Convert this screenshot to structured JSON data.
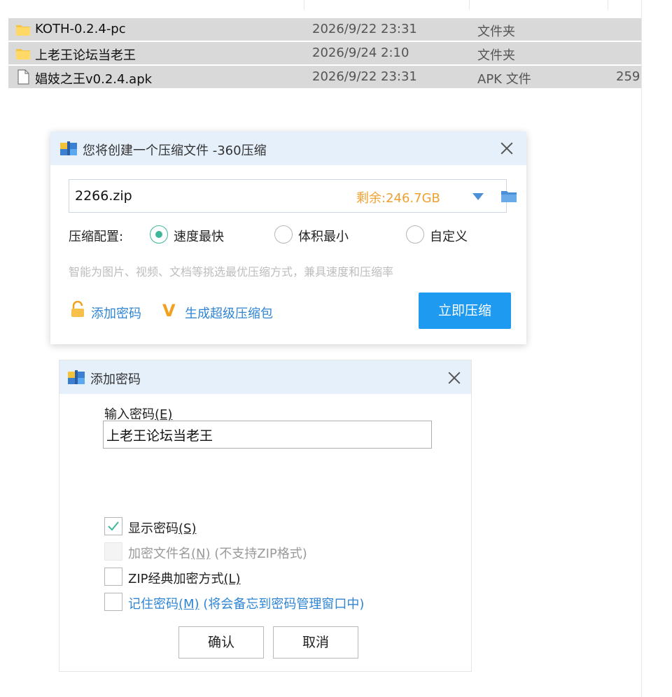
{
  "explorer": {
    "files": [
      {
        "name": "KOTH-0.2.4-pc",
        "date": "2026/9/22 23:31",
        "type": "文件夹",
        "size": "",
        "icon": "folder-icon",
        "selected": true
      },
      {
        "name": "上老王论坛当老王",
        "date": "2026/9/24 2:10",
        "type": "文件夹",
        "size": "",
        "icon": "folder-icon",
        "selected": true
      },
      {
        "name": "娼妓之王v0.2.4.apk",
        "date": "2026/9/22 23:31",
        "type": "APK 文件",
        "size": "259",
        "icon": "file-icon",
        "selected": true
      }
    ]
  },
  "compress_dialog": {
    "title": "您将创建一个压缩文件 -360压缩",
    "filename": "2266.zip",
    "free_space": "剩余:246.7GB",
    "config_label": "压缩配置:",
    "options": [
      {
        "label": "速度最快",
        "checked": true
      },
      {
        "label": "体积最小",
        "checked": false
      },
      {
        "label": "自定义",
        "checked": false
      }
    ],
    "hint": "智能为图片、视频、文档等挑选最优压缩方式，兼具速度和压缩率",
    "add_password_label": "添加密码",
    "super_pack_label": "生成超级压缩包",
    "compress_button": "立即压缩",
    "accent_color": "#1e9bf0",
    "free_space_color": "#f0a030"
  },
  "password_dialog": {
    "title": "添加密码",
    "input_label": "输入密码",
    "input_accel": "(E)",
    "input_value": "上老王论坛当老王",
    "checkboxes": [
      {
        "label": "显示密码",
        "accel": "(S)",
        "suffix": "",
        "checked": true,
        "disabled": false,
        "link": false
      },
      {
        "label": "加密文件名",
        "accel": "(N)",
        "suffix": " (不支持ZIP格式)",
        "checked": false,
        "disabled": true,
        "link": false
      },
      {
        "label": "ZIP经典加密方式",
        "accel": "(L)",
        "suffix": "",
        "checked": false,
        "disabled": false,
        "link": false
      },
      {
        "label": "记住密码",
        "accel": "(M)",
        "suffix": " (将会备忘到密码管理窗口中)",
        "checked": false,
        "disabled": false,
        "link": true
      }
    ],
    "ok_button": "确认",
    "cancel_button": "取消",
    "check_color": "#3fb79a"
  }
}
